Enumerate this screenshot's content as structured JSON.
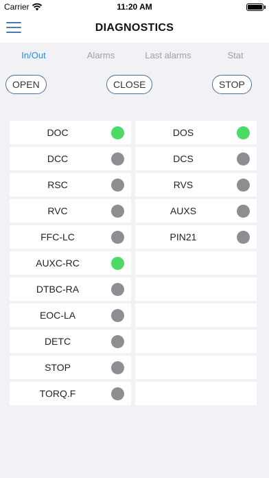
{
  "status_bar": {
    "carrier": "Carrier",
    "time": "11:20 AM"
  },
  "header": {
    "title": "DIAGNOSTICS",
    "menu_icon": "hamburger-menu-icon"
  },
  "tabs": [
    {
      "label": "In/Out",
      "active": true
    },
    {
      "label": "Alarms",
      "active": false
    },
    {
      "label": "Last alarms",
      "active": false
    },
    {
      "label": "Stat",
      "active": false
    }
  ],
  "controls": {
    "open_label": "OPEN",
    "close_label": "CLOSE",
    "stop_label": "STOP"
  },
  "colors": {
    "led_on": "#4cd964",
    "led_off": "#8e8e92",
    "active_tab": "#1d8de6",
    "button_border": "#4b6e94"
  },
  "signals": {
    "left": [
      {
        "label": "DOC",
        "state": "on"
      },
      {
        "label": "DCC",
        "state": "off"
      },
      {
        "label": "RSC",
        "state": "off"
      },
      {
        "label": "RVC",
        "state": "off"
      },
      {
        "label": "FFC-LC",
        "state": "off"
      },
      {
        "label": "AUXC-RC",
        "state": "on"
      },
      {
        "label": "DTBC-RA",
        "state": "off"
      },
      {
        "label": "EOC-LA",
        "state": "off"
      },
      {
        "label": "DETC",
        "state": "off"
      },
      {
        "label": "STOP",
        "state": "off"
      },
      {
        "label": "TORQ.F",
        "state": "off"
      }
    ],
    "right": [
      {
        "label": "DOS",
        "state": "on"
      },
      {
        "label": "DCS",
        "state": "off"
      },
      {
        "label": "RVS",
        "state": "off"
      },
      {
        "label": "AUXS",
        "state": "off"
      },
      {
        "label": "PIN21",
        "state": "off"
      },
      null,
      null,
      null,
      null,
      null,
      null
    ]
  }
}
